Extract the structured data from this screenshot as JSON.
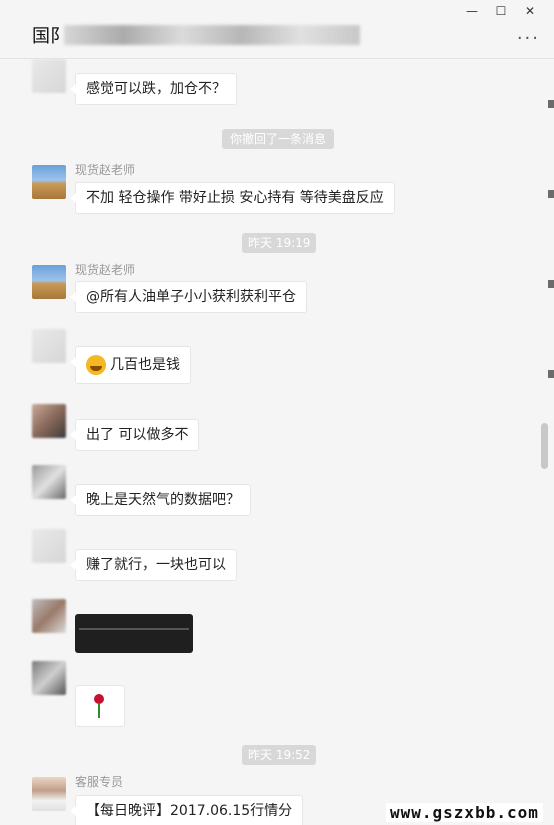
{
  "window": {
    "title": "国阝",
    "minimize": "—",
    "maximize": "☐",
    "close": "✕",
    "more": "···"
  },
  "messages": [
    {
      "text": "感觉可以跌，加仓不？"
    },
    {
      "system": "你撤回了一条消息"
    },
    {
      "sender": "现货赵老师",
      "text": "不加  轻仓操作  带好止损 安心持有   等待美盘反应"
    },
    {
      "time": "昨天 19:19"
    },
    {
      "sender": "现货赵老师",
      "text": "@所有人油单子小小获利获利平仓"
    },
    {
      "text": "几百也是钱"
    },
    {
      "text": "出了 可以做多不"
    },
    {
      "text": "晚上是天然气的数据吧？"
    },
    {
      "text": "赚了就行，一块也可以"
    },
    {
      "time": "昨天 19:52"
    },
    {
      "sender": "客服专员",
      "text": "【每日晚评】2017.06.15行情分"
    }
  ],
  "watermark": "www.gszxbb.com",
  "colors": {
    "background": "#f5f5f5",
    "bubble": "#ffffff",
    "system_badge": "#d8d8d8"
  }
}
